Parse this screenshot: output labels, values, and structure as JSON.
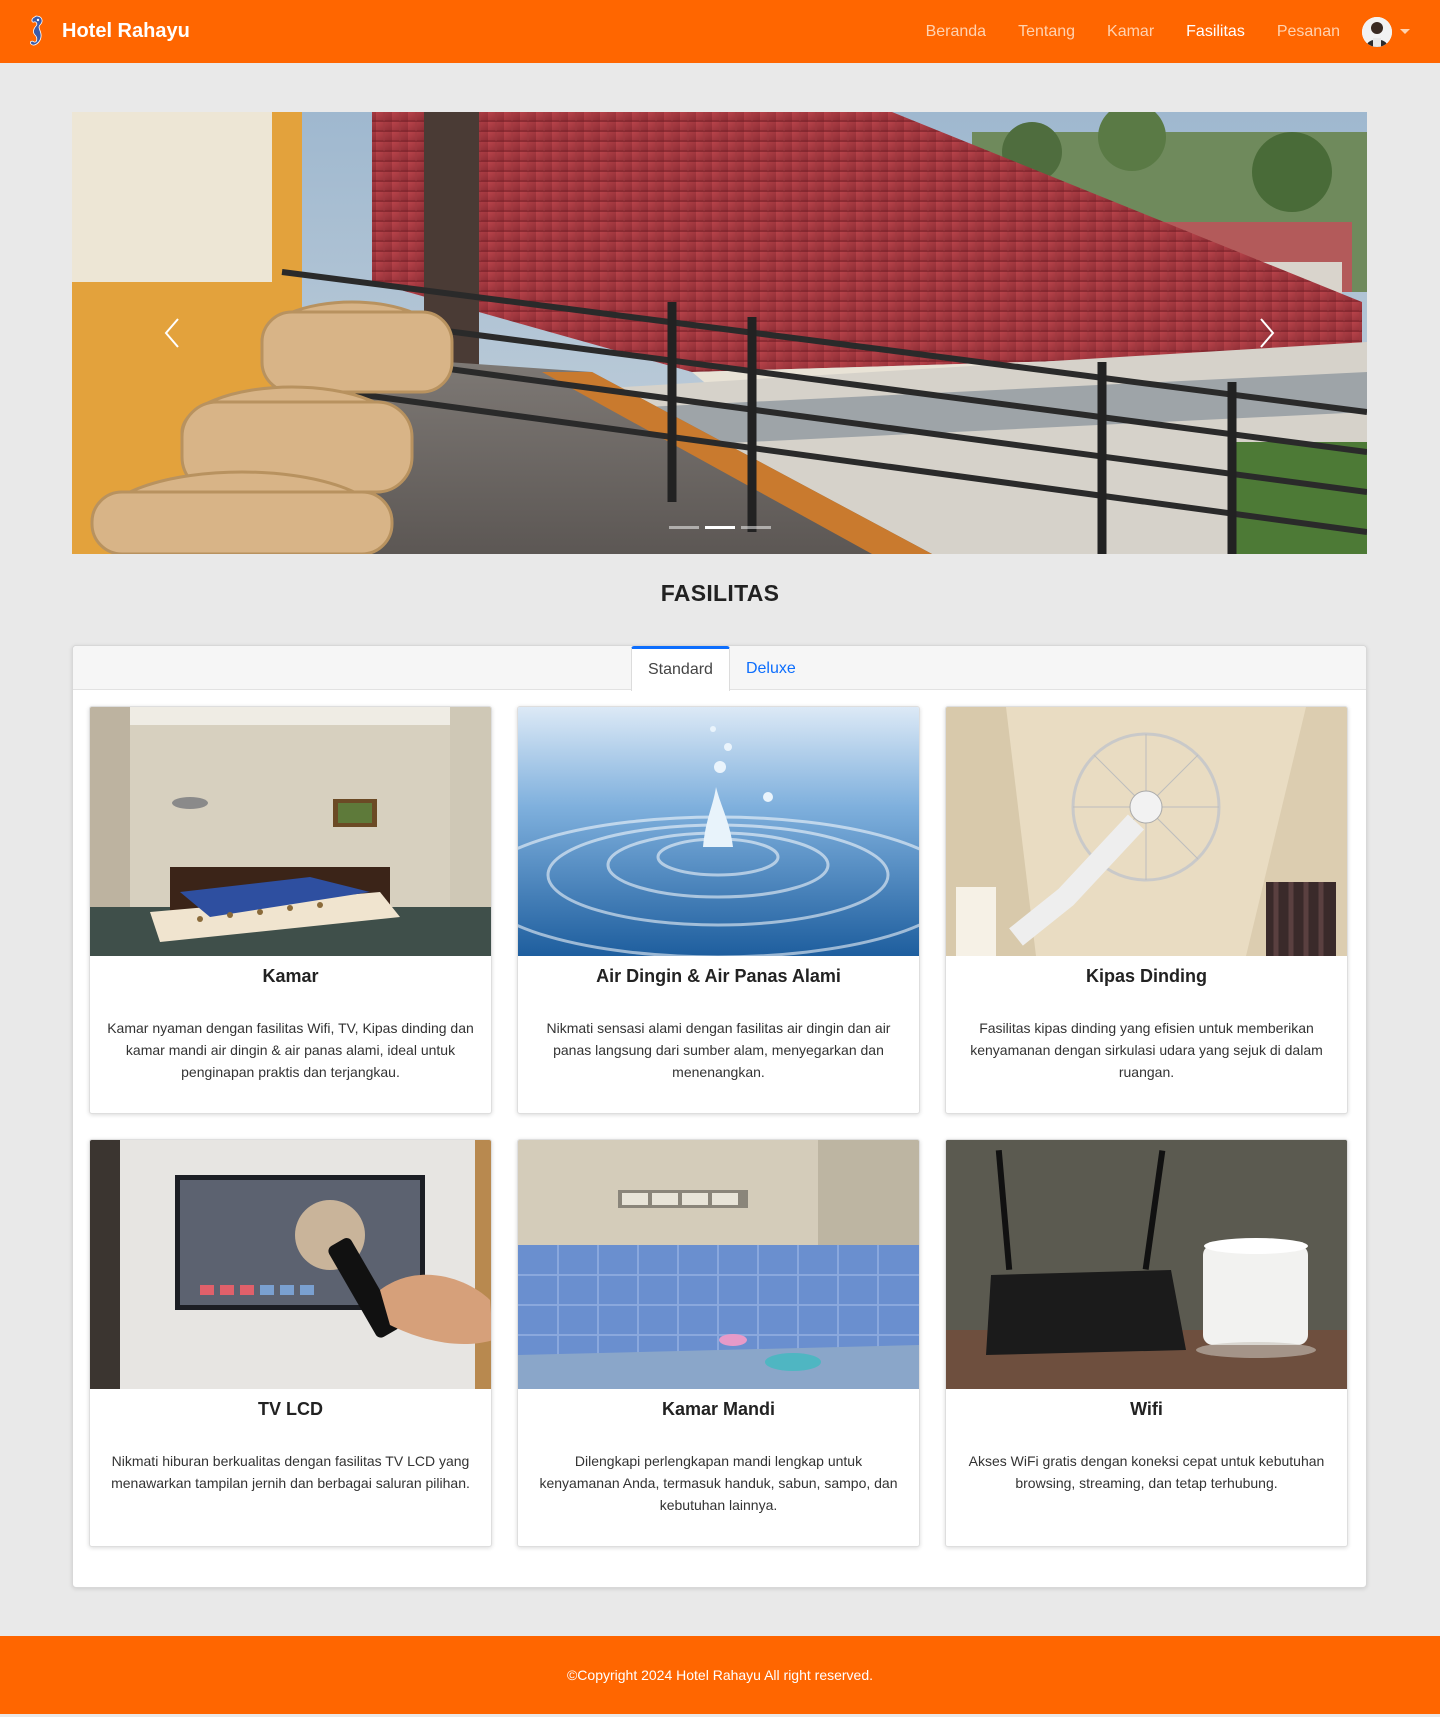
{
  "brand": {
    "name": "Hotel Rahayu",
    "logo_icon": "seahorse-logo-icon"
  },
  "nav": {
    "items": [
      {
        "label": "Beranda",
        "active": false
      },
      {
        "label": "Tentang",
        "active": false
      },
      {
        "label": "Kamar",
        "active": false
      },
      {
        "label": "Fasilitas",
        "active": true
      },
      {
        "label": "Pesanan",
        "active": false
      }
    ],
    "avatar_icon": "user-avatar-icon",
    "dropdown_icon": "caret-down-icon"
  },
  "carousel": {
    "slide_count": 3,
    "active_index": 1,
    "prev_icon": "chevron-left-icon",
    "next_icon": "chevron-right-icon"
  },
  "section": {
    "title": "FASILITAS"
  },
  "tabs": [
    {
      "label": "Standard",
      "active": true
    },
    {
      "label": "Deluxe",
      "active": false
    }
  ],
  "cards": [
    {
      "title": "Kamar",
      "text": "Kamar nyaman dengan fasilitas Wifi, TV, Kipas dinding dan kamar mandi air dingin & air panas alami, ideal untuk penginapan praktis dan terjangkau."
    },
    {
      "title": "Air Dingin & Air Panas Alami",
      "text": "Nikmati sensasi alami dengan fasilitas air dingin dan air panas langsung dari sumber alam, menyegarkan dan menenangkan."
    },
    {
      "title": "Kipas Dinding",
      "text": "Fasilitas kipas dinding yang efisien untuk memberikan kenyamanan dengan sirkulasi udara yang sejuk di dalam ruangan."
    },
    {
      "title": "TV LCD",
      "text": "Nikmati hiburan berkualitas dengan fasilitas TV LCD yang menawarkan tampilan jernih dan berbagai saluran pilihan."
    },
    {
      "title": "Kamar Mandi",
      "text": "Dilengkapi perlengkapan mandi lengkap untuk kenyamanan Anda, termasuk handuk, sabun, sampo, dan kebutuhan lainnya."
    },
    {
      "title": "Wifi",
      "text": "Akses WiFi gratis dengan koneksi cepat untuk kebutuhan browsing, streaming, dan tetap terhubung."
    }
  ],
  "footer": {
    "text": "©Copyright 2024 Hotel Rahayu All right reserved."
  },
  "colors": {
    "primary": "#ff6600",
    "background": "#e9e9e9",
    "tab_accent": "#0d6efd"
  }
}
